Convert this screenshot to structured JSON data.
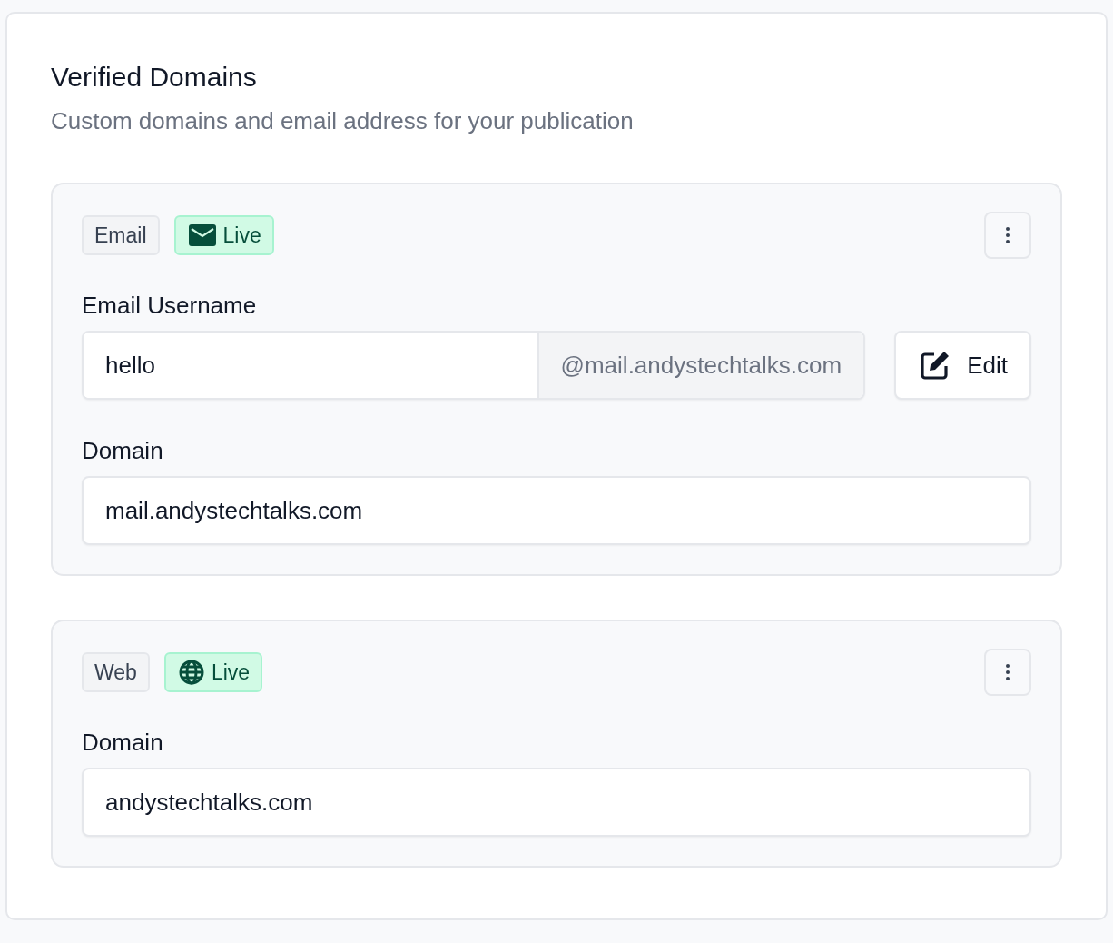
{
  "section": {
    "title": "Verified Domains",
    "subtitle": "Custom domains and email address for your publication"
  },
  "domains": [
    {
      "kind": "email",
      "type_label": "Email",
      "status": {
        "label": "Live"
      },
      "fields": [
        {
          "kind": "email",
          "label": "Email Username",
          "value": "hello",
          "suffix": "@mail.andystechtalks.com",
          "button": "Edit"
        },
        {
          "kind": "plain",
          "label": "Domain",
          "value": "mail.andystechtalks.com"
        }
      ]
    },
    {
      "kind": "web",
      "type_label": "Web",
      "status": {
        "label": "Live"
      },
      "fields": [
        {
          "kind": "plain",
          "label": "Domain",
          "value": "andystechtalks.com"
        }
      ]
    }
  ]
}
